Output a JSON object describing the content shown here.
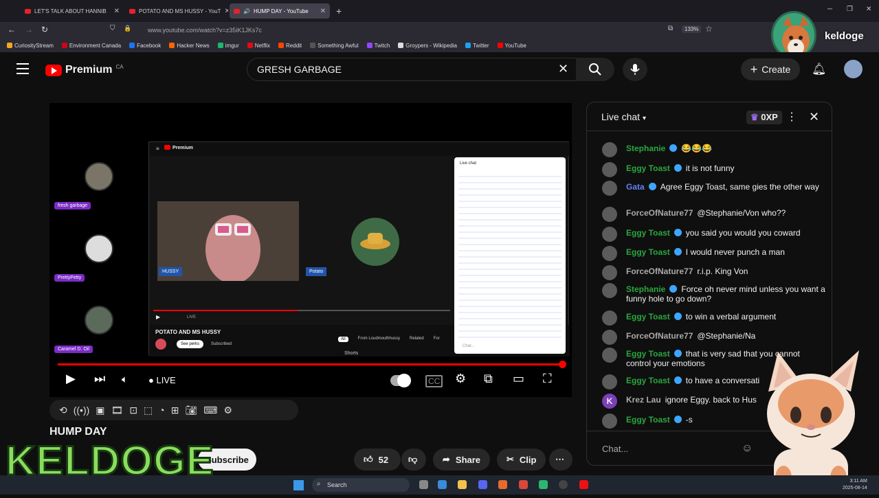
{
  "browser": {
    "tabs": [
      {
        "label": "LET'S TALK ABOUT HANNIB"
      },
      {
        "label": "POTATO AND MS HUSSY - YouT"
      },
      {
        "label": "HUMP DAY - YouTube"
      }
    ],
    "url": "www.youtube.com/watch?v=z35iK1JKs7c",
    "zoom": "133%",
    "bookmarks": [
      {
        "label": "CuriosityStream",
        "color": "#f6a623"
      },
      {
        "label": "Environment Canada",
        "color": "#d0021b"
      },
      {
        "label": "Facebook",
        "color": "#1877f2"
      },
      {
        "label": "Hacker News",
        "color": "#ff6600"
      },
      {
        "label": "imgur",
        "color": "#1bb76e"
      },
      {
        "label": "Netflix",
        "color": "#e50914"
      },
      {
        "label": "Reddit",
        "color": "#ff4500"
      },
      {
        "label": "Something Awful",
        "color": "#555555"
      },
      {
        "label": "Twitch",
        "color": "#9146ff"
      },
      {
        "label": "Groypers - Wikipedia",
        "color": "#dddddd"
      },
      {
        "label": "Twitter",
        "color": "#1da1f2"
      },
      {
        "label": "YouTube",
        "color": "#ff0000"
      }
    ]
  },
  "overlay": {
    "name": "keldoge",
    "brand": "KELDOGE"
  },
  "youtube": {
    "logo": "Premium",
    "region": "CA",
    "search_value": "GRESH GARBAGE",
    "create_label": "Create"
  },
  "video": {
    "participants": [
      "fresh garbage",
      "PrettyPetty",
      "Caramel D. Oil"
    ],
    "inner": {
      "labels": [
        "HUSSY",
        "Potato"
      ],
      "title": "POTATO AND MS HUSSY",
      "see_perks": "See perks",
      "subscribed": "Subscribed",
      "filters": [
        "All",
        "From Loudmouthhussy",
        "Related",
        "For"
      ],
      "shorts": "Shorts",
      "live": "LIVE",
      "chat_title": "Live chat",
      "chat_placeholder": "Chat..."
    },
    "live_label": "LIVE",
    "title": "HUMP DAY",
    "subscribe_label": "Subscribe",
    "likes": "52",
    "share_label": "Share",
    "clip_label": "Clip"
  },
  "chat": {
    "title": "Live chat",
    "xp": "0XP",
    "placeholder": "Chat...",
    "messages": [
      {
        "author": "Stephanie",
        "text": "😂😂😂",
        "color": "green",
        "badge": true
      },
      {
        "author": "Eggy Toast",
        "text": "it is not funny",
        "color": "green",
        "badge": true
      },
      {
        "author": "Gata",
        "text": "Agree Eggy Toast, same gies the other way",
        "color": "blue",
        "badge": true
      },
      {
        "author": "ForceOfNature77",
        "text": "@Stephanie/Von who??",
        "color": "gray",
        "badge": false
      },
      {
        "author": "Eggy Toast",
        "text": "you said you would you coward",
        "color": "green",
        "badge": true
      },
      {
        "author": "Eggy Toast",
        "text": "I would never punch a man",
        "color": "green",
        "badge": true
      },
      {
        "author": "ForceOfNature77",
        "text": "r.i.p. King Von",
        "color": "gray",
        "badge": false
      },
      {
        "author": "Stephanie",
        "text": "Force oh never mind unless you want a funny hole to go down?",
        "color": "green",
        "badge": true
      },
      {
        "author": "Eggy Toast",
        "text": "to win a verbal argument",
        "color": "green",
        "badge": true
      },
      {
        "author": "ForceOfNature77",
        "text": "@Stephanie/Na",
        "color": "gray",
        "badge": false
      },
      {
        "author": "Eggy Toast",
        "text": "that is very sad that you cannot control your emotions",
        "color": "green",
        "badge": true
      },
      {
        "author": "Eggy Toast",
        "text": "to have a conversati",
        "color": "green",
        "badge": true
      },
      {
        "author": "Krez Lau",
        "text": "ignore Eggy. back to Hus",
        "color": "gray",
        "badge": false
      },
      {
        "author": "Eggy Toast",
        "text": "-s",
        "color": "green",
        "badge": true
      }
    ]
  },
  "taskbar": {
    "search_placeholder": "Search",
    "time": "3:11 AM",
    "date": "2025-08-14"
  }
}
